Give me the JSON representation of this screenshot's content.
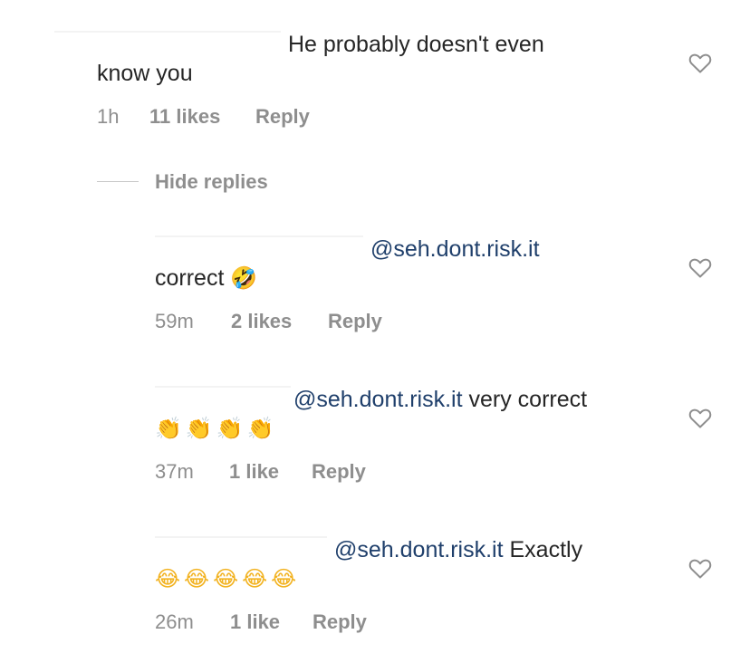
{
  "comments": [
    {
      "line1": "He probably doesn't even",
      "line2": "know you",
      "time": "1h",
      "likes": "11 likes",
      "reply": "Reply"
    }
  ],
  "hide_replies": "Hide replies",
  "replies": [
    {
      "mention": "@seh.dont.risk.it",
      "text_after": "",
      "line2": "correct",
      "emoji": "🤣",
      "time": "59m",
      "likes": "2 likes",
      "reply": "Reply"
    },
    {
      "mention": "@seh.dont.risk.it",
      "text_after": " very correct",
      "line2": "",
      "emoji": "👏👏👏👏",
      "time": "37m",
      "likes": "1 like",
      "reply": "Reply"
    },
    {
      "mention": "@seh.dont.risk.it",
      "text_after": " Exactly",
      "line2": "",
      "emoji": "😂😂😂😂😂",
      "time": "26m",
      "likes": "1 like",
      "reply": "Reply"
    }
  ],
  "icons": {
    "like": "heart-outline-icon"
  },
  "colors": {
    "mention": "#1f3f6b",
    "meta": "#8e8e8e",
    "text": "#262626"
  }
}
